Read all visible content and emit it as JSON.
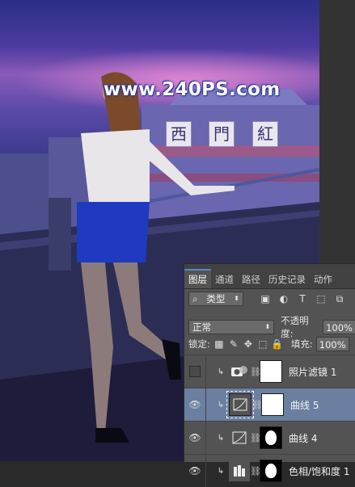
{
  "watermark": "www.240PS.com",
  "signs": [
    "西",
    "門",
    "紅"
  ],
  "layers_panel": {
    "tabs": [
      "图层",
      "通道",
      "路径",
      "历史记录",
      "动作"
    ],
    "filter": {
      "type_label": "类型"
    },
    "blend_mode": "正常",
    "opacity": {
      "label": "不透明度:",
      "value": "100%"
    },
    "lock": {
      "label": "锁定:"
    },
    "fill": {
      "label": "填充:",
      "value": "100%"
    },
    "layers": [
      {
        "name": "照片滤镜 1",
        "visible": false,
        "clipped": true,
        "selected": false,
        "type": "photo-filter",
        "mask": "white"
      },
      {
        "name": "曲线 5",
        "visible": true,
        "clipped": true,
        "selected": true,
        "type": "curves",
        "mask": "white"
      },
      {
        "name": "曲线 4",
        "visible": true,
        "clipped": true,
        "selected": false,
        "type": "curves",
        "mask": "black-with-white-shape"
      },
      {
        "name": "色相/饱和度 1",
        "visible": true,
        "clipped": true,
        "selected": false,
        "type": "hue-saturation",
        "mask": "black-with-white-shape"
      }
    ]
  },
  "colors": {
    "panel_bg": "#535353",
    "selected_layer": "#6b7fa0",
    "sky_glow": "#ff96dc"
  }
}
